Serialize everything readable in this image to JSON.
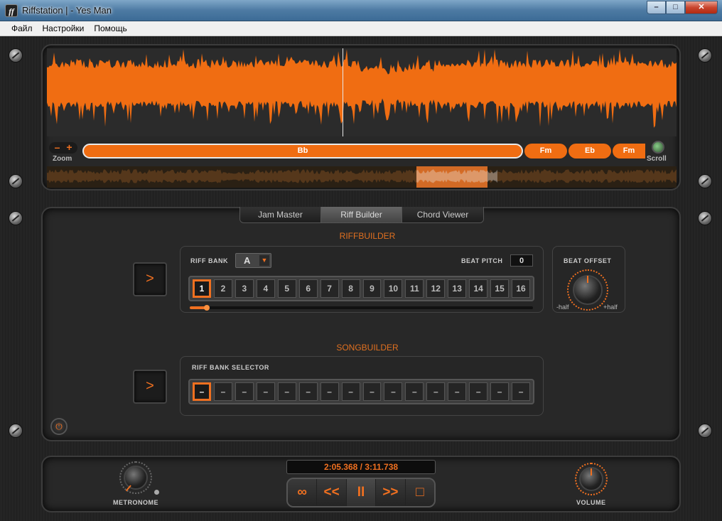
{
  "window": {
    "title": "Riffstation |  - Yes Man",
    "app_icon": "ff",
    "minimize": "–",
    "maximize": "□",
    "close": "✕"
  },
  "menu": {
    "items": [
      "Файл",
      "Настройки",
      "Помощь"
    ]
  },
  "waveform": {
    "zoom_minus": "–",
    "zoom_plus": "+",
    "zoom_label": "Zoom",
    "scroll_label": "Scroll",
    "chords": [
      "Bb",
      "Fm",
      "Eb",
      "Fm"
    ],
    "playhead_position": 0.47,
    "overview_window": [
      0.587,
      0.7
    ]
  },
  "tabs": [
    "Jam Master",
    "Riff Builder",
    "Chord Viewer"
  ],
  "active_tab": "Riff Builder",
  "riffbuilder": {
    "title": "RIFFBUILDER",
    "play_label": ">",
    "bank_label": "RIFF BANK",
    "bank_value": "A",
    "bank_arrow": "▼",
    "pitch_label": "BEAT PITCH",
    "pitch_value": "0",
    "slots": [
      "1",
      "2",
      "3",
      "4",
      "5",
      "6",
      "7",
      "8",
      "9",
      "10",
      "11",
      "12",
      "13",
      "14",
      "15",
      "16"
    ],
    "selected_slot": 0,
    "progress": 0.05
  },
  "beat_offset": {
    "label": "BEAT OFFSET",
    "min_label": "-half",
    "max_label": "+half"
  },
  "songbuilder": {
    "title": "SONGBUILDER",
    "play_label": ">",
    "selector_label": "RIFF BANK SELECTOR",
    "slots": [
      "–",
      "–",
      "–",
      "–",
      "–",
      "–",
      "–",
      "–",
      "–",
      "–",
      "–",
      "–",
      "–",
      "–",
      "–",
      "–"
    ],
    "selected_slot": 0
  },
  "power_icon": "⏻",
  "transport": {
    "time": "2:05.368 / 3:11.738",
    "buttons": [
      "∞",
      "<<",
      "II",
      ">>",
      "□"
    ]
  },
  "metronome_label": "METRONOME",
  "volume_label": "VOLUME",
  "colors": {
    "accent": "#f06d12",
    "background": "#222222"
  }
}
